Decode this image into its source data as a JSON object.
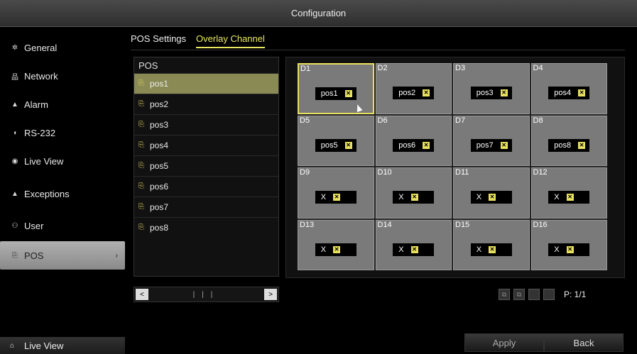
{
  "window": {
    "title": "Configuration"
  },
  "sidebar": {
    "items": [
      {
        "label": "General",
        "icon": "gear-icon",
        "glyph": "✲"
      },
      {
        "label": "Network",
        "icon": "network-icon",
        "glyph": "品"
      },
      {
        "label": "Alarm",
        "icon": "alarm-icon",
        "glyph": "▲"
      },
      {
        "label": "RS-232",
        "icon": "rs232-icon",
        "glyph": "◖"
      },
      {
        "label": "Live View",
        "icon": "eye-icon",
        "glyph": "◉"
      },
      {
        "label": "Exceptions",
        "icon": "warning-icon",
        "glyph": "▲"
      },
      {
        "label": "User",
        "icon": "user-icon",
        "glyph": "⚇"
      },
      {
        "label": "POS",
        "icon": "pos-icon",
        "glyph": "⎘"
      }
    ],
    "active_index": 7,
    "bottom_label": "Live View",
    "bottom_icon": "home-icon"
  },
  "tabs": [
    {
      "label": "POS Settings"
    },
    {
      "label": "Overlay Channel"
    }
  ],
  "pos_list": {
    "header": "POS",
    "items": [
      "pos1",
      "pos2",
      "pos3",
      "pos4",
      "pos5",
      "pos6",
      "pos7",
      "pos8"
    ],
    "selected_index": 0
  },
  "grid": {
    "cells": [
      {
        "label": "D1",
        "chip": "pos1"
      },
      {
        "label": "D2",
        "chip": "pos2"
      },
      {
        "label": "D3",
        "chip": "pos3"
      },
      {
        "label": "D4",
        "chip": "pos4"
      },
      {
        "label": "D5",
        "chip": "pos5"
      },
      {
        "label": "D6",
        "chip": "pos6"
      },
      {
        "label": "D7",
        "chip": "pos7"
      },
      {
        "label": "D8",
        "chip": "pos8"
      },
      {
        "label": "D9",
        "chip": "X"
      },
      {
        "label": "D10",
        "chip": "X"
      },
      {
        "label": "D11",
        "chip": "X"
      },
      {
        "label": "D12",
        "chip": "X"
      },
      {
        "label": "D13",
        "chip": "X"
      },
      {
        "label": "D14",
        "chip": "X"
      },
      {
        "label": "D15",
        "chip": "X"
      },
      {
        "label": "D16",
        "chip": "X"
      }
    ],
    "selected_index": 0
  },
  "pager": {
    "text": "P: 1/1"
  },
  "buttons": {
    "apply": "Apply",
    "back": "Back"
  },
  "colors": {
    "accent": "#e8e060",
    "selected_row": "#8a8a55",
    "cell_bg": "#7a7a7a"
  }
}
